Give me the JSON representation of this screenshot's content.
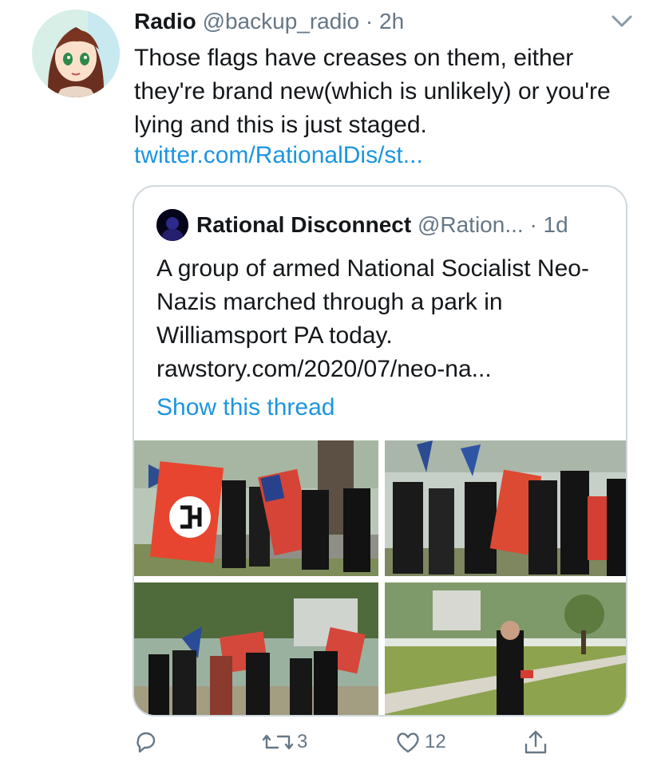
{
  "tweet": {
    "author_name": "Radio",
    "author_handle": "@backup_radio",
    "separator": "·",
    "time": "2h",
    "text": "Those flags have creases on them, either they're brand new(which is unlikely) or you're lying and this is just staged.",
    "link": "twitter.com/RationalDis/st..."
  },
  "quoted": {
    "author_name": "Rational Disconnect",
    "author_handle": "@Ration...",
    "separator": "·",
    "time": "1d",
    "text": "A group of armed National Socialist Neo-Nazis marched through a park in Williamsport PA today.",
    "link": "rawstory.com/2020/07/neo-na...",
    "show_thread": "Show this thread"
  },
  "actions": {
    "reply_icon": "reply-icon",
    "retweet_count": "3",
    "like_count": "12",
    "share_icon": "share-icon"
  },
  "colors": {
    "link": "#1b95e0",
    "secondary_text": "#657786",
    "border": "#cfd9de"
  }
}
